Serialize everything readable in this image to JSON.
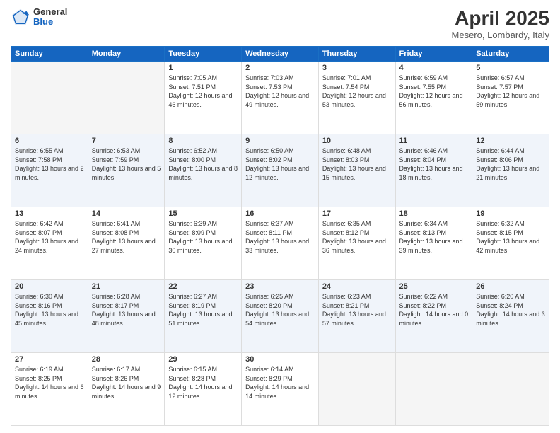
{
  "header": {
    "logo": {
      "general": "General",
      "blue": "Blue"
    },
    "title": "April 2025",
    "location": "Mesero, Lombardy, Italy"
  },
  "days_of_week": [
    "Sunday",
    "Monday",
    "Tuesday",
    "Wednesday",
    "Thursday",
    "Friday",
    "Saturday"
  ],
  "weeks": [
    [
      null,
      null,
      {
        "day": 1,
        "sunrise": "7:05 AM",
        "sunset": "7:51 PM",
        "daylight": "12 hours and 46 minutes."
      },
      {
        "day": 2,
        "sunrise": "7:03 AM",
        "sunset": "7:53 PM",
        "daylight": "12 hours and 49 minutes."
      },
      {
        "day": 3,
        "sunrise": "7:01 AM",
        "sunset": "7:54 PM",
        "daylight": "12 hours and 53 minutes."
      },
      {
        "day": 4,
        "sunrise": "6:59 AM",
        "sunset": "7:55 PM",
        "daylight": "12 hours and 56 minutes."
      },
      {
        "day": 5,
        "sunrise": "6:57 AM",
        "sunset": "7:57 PM",
        "daylight": "12 hours and 59 minutes."
      }
    ],
    [
      {
        "day": 6,
        "sunrise": "6:55 AM",
        "sunset": "7:58 PM",
        "daylight": "13 hours and 2 minutes."
      },
      {
        "day": 7,
        "sunrise": "6:53 AM",
        "sunset": "7:59 PM",
        "daylight": "13 hours and 5 minutes."
      },
      {
        "day": 8,
        "sunrise": "6:52 AM",
        "sunset": "8:00 PM",
        "daylight": "13 hours and 8 minutes."
      },
      {
        "day": 9,
        "sunrise": "6:50 AM",
        "sunset": "8:02 PM",
        "daylight": "13 hours and 12 minutes."
      },
      {
        "day": 10,
        "sunrise": "6:48 AM",
        "sunset": "8:03 PM",
        "daylight": "13 hours and 15 minutes."
      },
      {
        "day": 11,
        "sunrise": "6:46 AM",
        "sunset": "8:04 PM",
        "daylight": "13 hours and 18 minutes."
      },
      {
        "day": 12,
        "sunrise": "6:44 AM",
        "sunset": "8:06 PM",
        "daylight": "13 hours and 21 minutes."
      }
    ],
    [
      {
        "day": 13,
        "sunrise": "6:42 AM",
        "sunset": "8:07 PM",
        "daylight": "13 hours and 24 minutes."
      },
      {
        "day": 14,
        "sunrise": "6:41 AM",
        "sunset": "8:08 PM",
        "daylight": "13 hours and 27 minutes."
      },
      {
        "day": 15,
        "sunrise": "6:39 AM",
        "sunset": "8:09 PM",
        "daylight": "13 hours and 30 minutes."
      },
      {
        "day": 16,
        "sunrise": "6:37 AM",
        "sunset": "8:11 PM",
        "daylight": "13 hours and 33 minutes."
      },
      {
        "day": 17,
        "sunrise": "6:35 AM",
        "sunset": "8:12 PM",
        "daylight": "13 hours and 36 minutes."
      },
      {
        "day": 18,
        "sunrise": "6:34 AM",
        "sunset": "8:13 PM",
        "daylight": "13 hours and 39 minutes."
      },
      {
        "day": 19,
        "sunrise": "6:32 AM",
        "sunset": "8:15 PM",
        "daylight": "13 hours and 42 minutes."
      }
    ],
    [
      {
        "day": 20,
        "sunrise": "6:30 AM",
        "sunset": "8:16 PM",
        "daylight": "13 hours and 45 minutes."
      },
      {
        "day": 21,
        "sunrise": "6:28 AM",
        "sunset": "8:17 PM",
        "daylight": "13 hours and 48 minutes."
      },
      {
        "day": 22,
        "sunrise": "6:27 AM",
        "sunset": "8:19 PM",
        "daylight": "13 hours and 51 minutes."
      },
      {
        "day": 23,
        "sunrise": "6:25 AM",
        "sunset": "8:20 PM",
        "daylight": "13 hours and 54 minutes."
      },
      {
        "day": 24,
        "sunrise": "6:23 AM",
        "sunset": "8:21 PM",
        "daylight": "13 hours and 57 minutes."
      },
      {
        "day": 25,
        "sunrise": "6:22 AM",
        "sunset": "8:22 PM",
        "daylight": "14 hours and 0 minutes."
      },
      {
        "day": 26,
        "sunrise": "6:20 AM",
        "sunset": "8:24 PM",
        "daylight": "14 hours and 3 minutes."
      }
    ],
    [
      {
        "day": 27,
        "sunrise": "6:19 AM",
        "sunset": "8:25 PM",
        "daylight": "14 hours and 6 minutes."
      },
      {
        "day": 28,
        "sunrise": "6:17 AM",
        "sunset": "8:26 PM",
        "daylight": "14 hours and 9 minutes."
      },
      {
        "day": 29,
        "sunrise": "6:15 AM",
        "sunset": "8:28 PM",
        "daylight": "14 hours and 12 minutes."
      },
      {
        "day": 30,
        "sunrise": "6:14 AM",
        "sunset": "8:29 PM",
        "daylight": "14 hours and 14 minutes."
      },
      null,
      null,
      null
    ]
  ],
  "labels": {
    "sunrise": "Sunrise:",
    "sunset": "Sunset:",
    "daylight": "Daylight:"
  }
}
